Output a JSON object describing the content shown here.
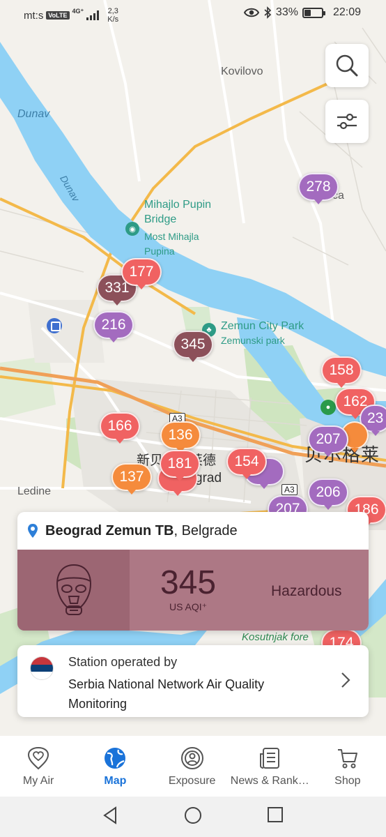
{
  "status_bar": {
    "carrier": "mt:s",
    "volte": "VoLTE",
    "network": "4G⁺",
    "speed_value": "2,3",
    "speed_unit": "K/s",
    "battery_percent": "33%",
    "battery_level": 0.33,
    "time": "22:09"
  },
  "map": {
    "labels": {
      "kovilovo": "Kovilovo",
      "dunav_1": "Dunav",
      "dunav_2": "Dunav",
      "bridge_name": "Mihajlo Pupin Bridge",
      "bridge_local": "Most Mihajla Pupina",
      "zemun_park": "Zemun City Park",
      "zemun_park_local": "Zemunski park",
      "ledine": "Ledine",
      "kosutnjak": "Kosutnjak fore",
      "cjk_beograd": "贝尔格莱",
      "cjk_novi": "新贝尔格莱德",
      "grad": "grad",
      "batajnica_tail": "čа",
      "road_a3_1": "A3",
      "road_a3_2": "A3"
    },
    "markers": [
      {
        "value": "278",
        "level": "purple"
      },
      {
        "value": "177",
        "level": "red"
      },
      {
        "value": "331",
        "level": "maroon"
      },
      {
        "value": "216",
        "level": "purple"
      },
      {
        "value": "345",
        "level": "maroon"
      },
      {
        "value": "158",
        "level": "red"
      },
      {
        "value": "162",
        "level": "red"
      },
      {
        "value": "23",
        "level": "purple"
      },
      {
        "value": "207",
        "level": "purple"
      },
      {
        "value": "166",
        "level": "red"
      },
      {
        "value": "136",
        "level": "orange"
      },
      {
        "value": "181",
        "level": "red"
      },
      {
        "value": "154",
        "level": "red"
      },
      {
        "value": "137",
        "level": "orange"
      },
      {
        "value": "206",
        "level": "purple"
      },
      {
        "value": "186",
        "level": "red"
      },
      {
        "value": "207",
        "level": "purple"
      },
      {
        "value": "174",
        "level": "red"
      }
    ]
  },
  "station": {
    "name": "Beograd Zemun TB",
    "city": ", Belgrade",
    "aqi": "345",
    "aqi_unit": "US AQI⁺",
    "level": "Hazardous",
    "color": "#ad7885",
    "icon": "gas-mask-icon"
  },
  "operator": {
    "label": "Station operated by",
    "name": "Serbia National Network Air Quality Monitoring",
    "flag_colors": [
      "#c6363c",
      "#0c4077",
      "#ffffff"
    ]
  },
  "nav": {
    "items": [
      {
        "label": "My Air",
        "icon": "heart-location-icon",
        "active": false
      },
      {
        "label": "Map",
        "icon": "globe-icon",
        "active": true
      },
      {
        "label": "Exposure",
        "icon": "exposure-icon",
        "active": false
      },
      {
        "label": "News & Rank…",
        "icon": "news-icon",
        "active": false
      },
      {
        "label": "Shop",
        "icon": "cart-icon",
        "active": false
      }
    ],
    "active_color": "#1a73d9"
  },
  "colors": {
    "aqi_red": "#f06262",
    "aqi_orange": "#f58b3c",
    "aqi_purple": "#a36bbf",
    "aqi_maroon": "#8c505a",
    "river": "#8fd1f5"
  }
}
